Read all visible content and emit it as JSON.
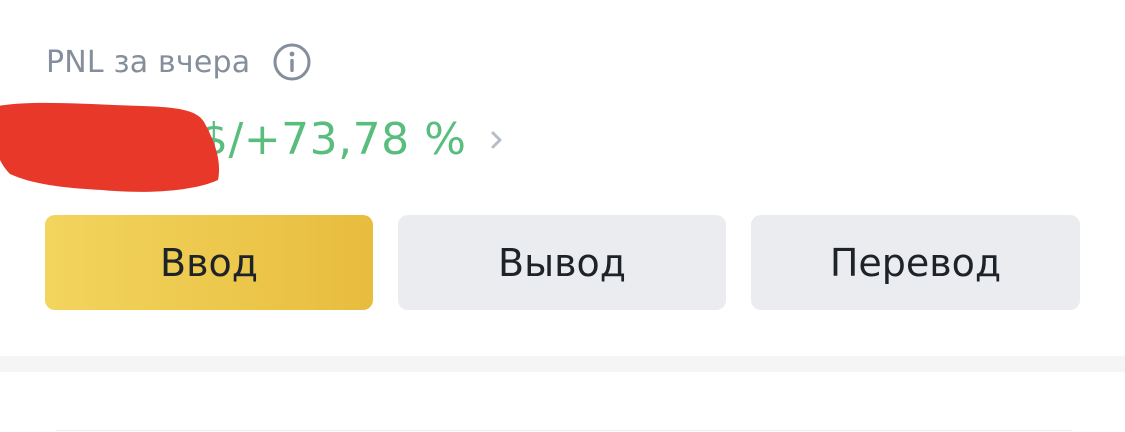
{
  "pnl": {
    "label": "PNL за вчера",
    "value_text": "$/+73,78 %",
    "value_color": "#58bd7d",
    "info_icon": "info-circle-icon",
    "chevron_icon": "chevron-right-icon"
  },
  "actions": {
    "deposit_label": "Ввод",
    "withdraw_label": "Вывод",
    "transfer_label": "Перевод"
  },
  "colors": {
    "primary_yellow": "#f0cb4f",
    "secondary_gray": "#eaecef",
    "label_gray": "#848e9c",
    "text_dark": "#1e2329"
  }
}
